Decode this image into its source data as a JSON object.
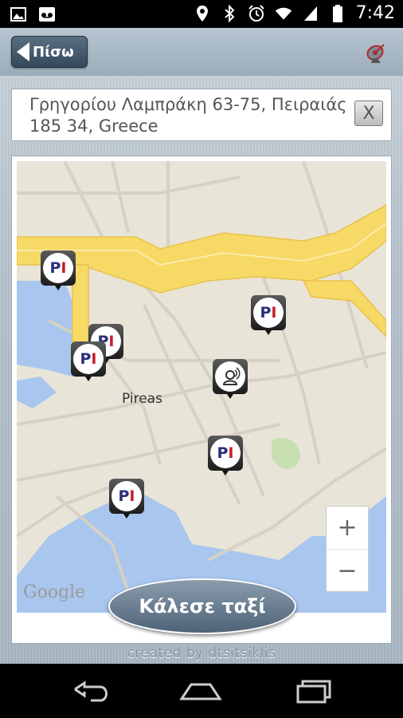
{
  "status_bar": {
    "time": "7:42",
    "left_icons": [
      "image-icon",
      "voicemail-icon"
    ],
    "right_icons": [
      "location-icon",
      "bluetooth-icon",
      "alarm-icon",
      "wifi-icon",
      "signal-icon",
      "battery-icon"
    ]
  },
  "header": {
    "back_label": "Πίσω",
    "right_icon": "satellite-dish-icon"
  },
  "address": {
    "value": "Γρηγορίου Λαμπράκη 63-75, Πειραιάς\n185 34, Greece",
    "clear_label": "X"
  },
  "map": {
    "city_label": "Pireas",
    "provider_logo": "Google",
    "zoom_in_label": "+",
    "zoom_out_label": "−",
    "markers": [
      {
        "type": "PI"
      },
      {
        "type": "PI"
      },
      {
        "type": "PI"
      },
      {
        "type": "PI"
      },
      {
        "type": "PI"
      },
      {
        "type": "PI"
      },
      {
        "type": "user-location"
      }
    ]
  },
  "actions": {
    "call_taxi_label": "Κάλεσε ταξί"
  },
  "footer": {
    "credit": "created by dtsitsiklis"
  },
  "nav_bar": {
    "buttons": [
      "back-icon",
      "home-icon",
      "recent-apps-icon"
    ]
  },
  "colors": {
    "marker_p": "#2a2f7a",
    "marker_i": "#c4202a",
    "highway": "#f7d966",
    "water": "#a9c6ef",
    "land": "#e9e4d8",
    "park": "#c8dfb1"
  }
}
